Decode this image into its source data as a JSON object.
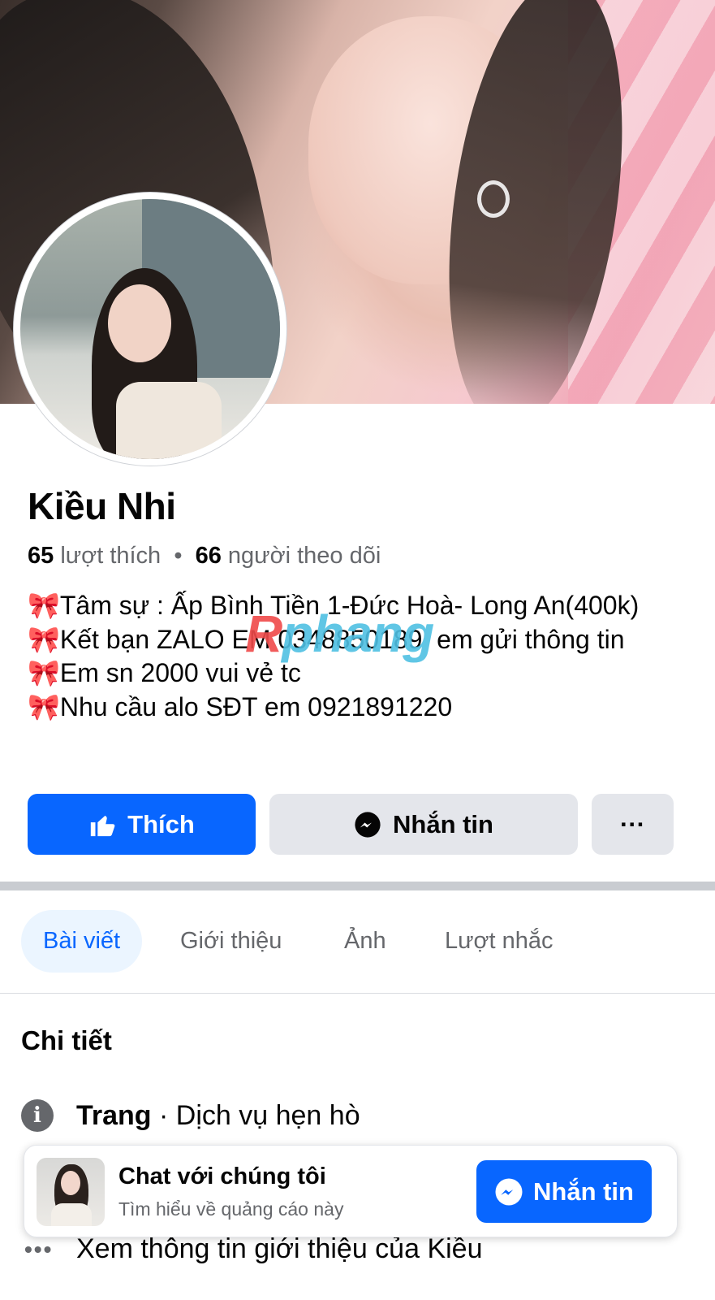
{
  "profile": {
    "name": "Kiều Nhi",
    "likes_count": "65",
    "likes_label": "lượt thích",
    "stats_separator": "•",
    "followers_count": "66",
    "followers_label": "người theo dõi",
    "bio_lines": [
      "🎀Tâm sự : Ấp Bình Tiền 1-Đức Hoà- Long An(400k)",
      "🎀Kết bạn ZALO EM 0348850189  em gửi thông tin",
      "🎀Em sn 2000 vui vẻ tc",
      "🎀Nhu cầu alo SĐT em 0921891220"
    ]
  },
  "watermark": {
    "first": "R",
    "rest": "phang"
  },
  "actions": {
    "like_label": "Thích",
    "message_label": "Nhắn tin",
    "more_label": "···"
  },
  "tabs": [
    {
      "label": "Bài viết",
      "active": true
    },
    {
      "label": "Giới thiệu",
      "active": false
    },
    {
      "label": "Ảnh",
      "active": false
    },
    {
      "label": "Lượt nhắc",
      "active": false
    }
  ],
  "details": {
    "title": "Chi tiết",
    "info_icon_glyph": "i",
    "type_strong": "Trang",
    "type_rest": " · Dịch vụ hẹn hò",
    "more_icon_glyph": "•••",
    "see_more": "Xem thông tin giới thiệu của Kiều"
  },
  "chat_card": {
    "title": "Chat với chúng tôi",
    "subtitle": "Tìm hiểu về quảng cáo này",
    "button_label": "Nhắn tin"
  },
  "colors": {
    "primary": "#0866ff",
    "secondary_button": "#e4e6eb",
    "muted_text": "#65676b",
    "active_tab_bg": "#ebf5ff"
  }
}
